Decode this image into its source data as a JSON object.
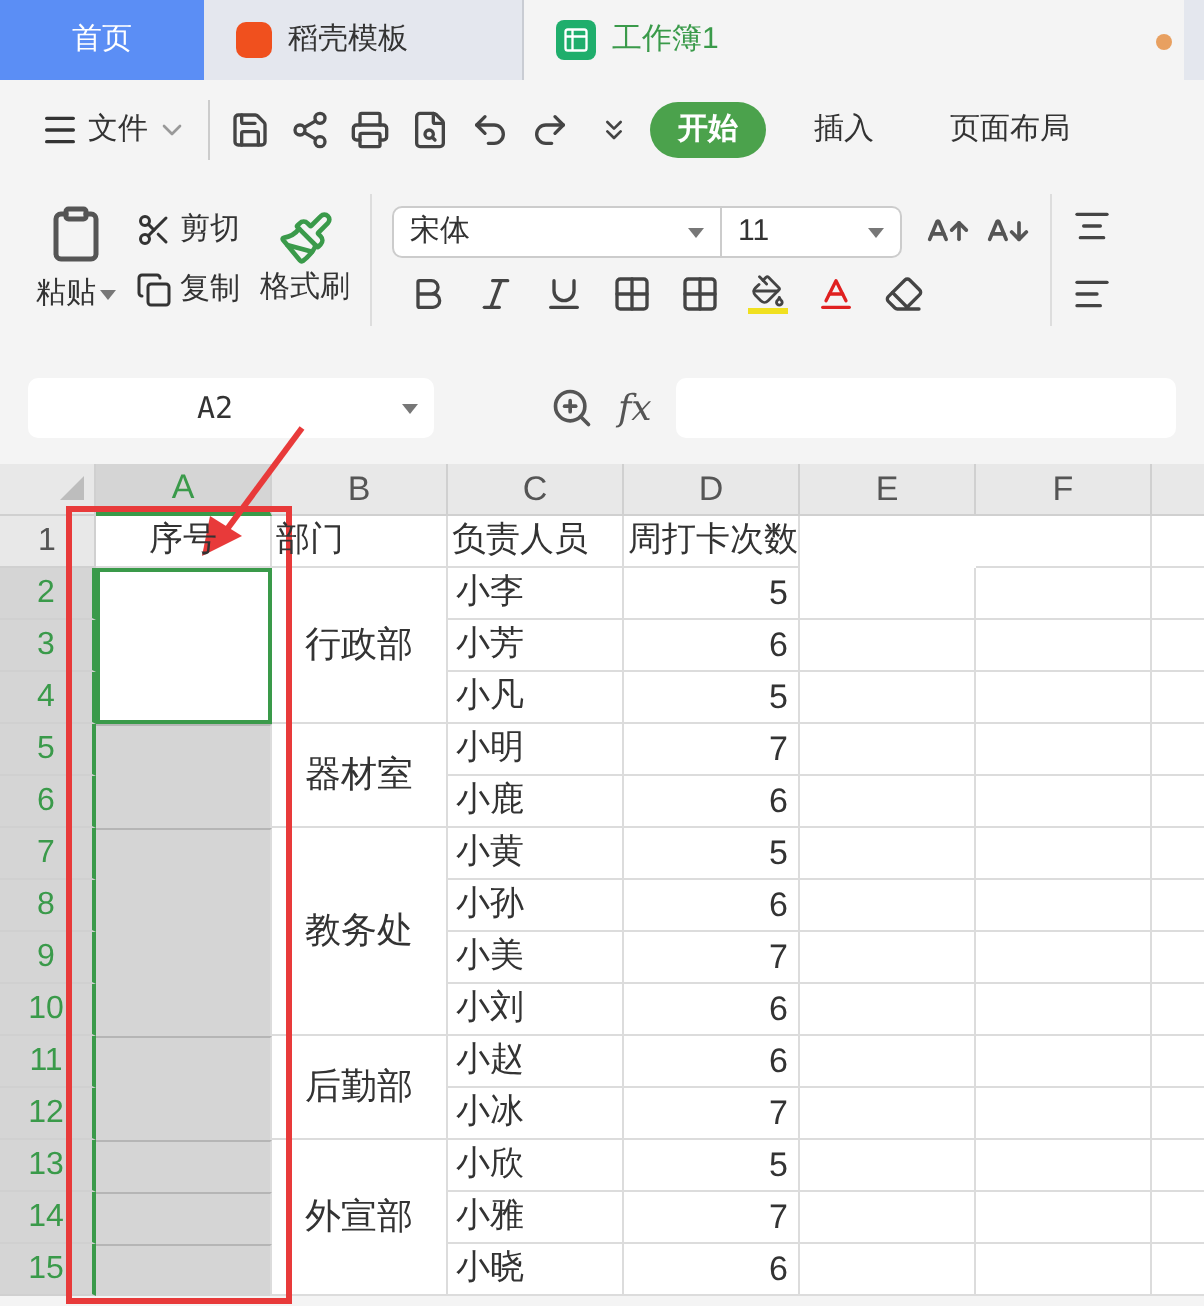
{
  "tabs": [
    {
      "kind": "home",
      "label": "首页",
      "selected": false
    },
    {
      "kind": "template",
      "label": "稻壳模板",
      "selected": false
    },
    {
      "kind": "sheet",
      "label": "工作簿1",
      "selected": true
    }
  ],
  "toolbar": {
    "file_menu": "文件",
    "ribbon_tabs": [
      {
        "label": "开始",
        "selected": true
      },
      {
        "label": "插入",
        "selected": false
      },
      {
        "label": "页面布局",
        "selected": false
      }
    ]
  },
  "ribbon": {
    "paste": "粘贴",
    "cut": "剪切",
    "copy": "复制",
    "format_painter": "格式刷",
    "font_name": "宋体",
    "font_size": "11"
  },
  "formula_bar": {
    "name_box": "A2",
    "fx": "fx"
  },
  "columns": [
    {
      "label": "A",
      "selected": true
    },
    {
      "label": "B",
      "selected": false
    },
    {
      "label": "C",
      "selected": false
    },
    {
      "label": "D",
      "selected": false
    },
    {
      "label": "E",
      "selected": false
    },
    {
      "label": "F",
      "selected": false
    }
  ],
  "header_row": {
    "num": "1",
    "selected": false,
    "cells": [
      "序号",
      "部门",
      "负责人员",
      "周打卡次数"
    ]
  },
  "groups": [
    {
      "department": "行政部",
      "rows": [
        {
          "num": "2",
          "selected": true,
          "active": true,
          "a_joined": false,
          "name": "小李",
          "count": "5"
        },
        {
          "num": "3",
          "selected": true,
          "active": true,
          "a_joined": true,
          "name": "小芳",
          "count": "6"
        },
        {
          "num": "4",
          "selected": true,
          "active": true,
          "a_joined": true,
          "name": "小凡",
          "count": "5"
        }
      ]
    },
    {
      "department": "器材室",
      "rows": [
        {
          "num": "5",
          "selected": true,
          "active": false,
          "a_joined": false,
          "name": "小明",
          "count": "7"
        },
        {
          "num": "6",
          "selected": true,
          "active": false,
          "a_joined": true,
          "name": "小鹿",
          "count": "6"
        }
      ]
    },
    {
      "department": "教务处",
      "rows": [
        {
          "num": "7",
          "selected": true,
          "active": false,
          "a_joined": false,
          "name": "小黄",
          "count": "5"
        },
        {
          "num": "8",
          "selected": true,
          "active": false,
          "a_joined": true,
          "name": "小孙",
          "count": "6"
        },
        {
          "num": "9",
          "selected": true,
          "active": false,
          "a_joined": true,
          "name": "小美",
          "count": "7"
        },
        {
          "num": "10",
          "selected": true,
          "active": false,
          "a_joined": true,
          "name": "小刘",
          "count": "6"
        }
      ]
    },
    {
      "department": "后勤部",
      "rows": [
        {
          "num": "11",
          "selected": true,
          "active": false,
          "a_joined": false,
          "name": "小赵",
          "count": "6"
        },
        {
          "num": "12",
          "selected": true,
          "active": false,
          "a_joined": true,
          "name": "小冰",
          "count": "7"
        }
      ]
    },
    {
      "department": "外宣部",
      "rows": [
        {
          "num": "13",
          "selected": true,
          "active": false,
          "a_joined": false,
          "name": "小欣",
          "count": "5"
        },
        {
          "num": "14",
          "selected": true,
          "active": false,
          "a_joined": false,
          "name": "小雅",
          "count": "7"
        },
        {
          "num": "15",
          "selected": true,
          "active": false,
          "a_joined": false,
          "name": "小晓",
          "count": "6"
        }
      ]
    }
  ]
}
